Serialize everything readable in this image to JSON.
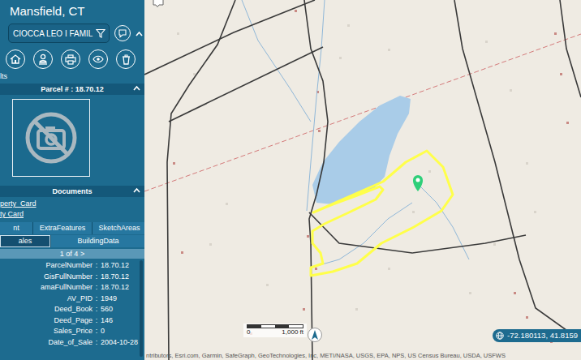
{
  "app": {
    "title": "Mansfield, CT"
  },
  "search": {
    "value": "CIOCCA LEO I FAMIL"
  },
  "results_label": "lts",
  "parcel": {
    "header": "Parcel # : 18.70.12"
  },
  "documents": {
    "header": "Documents",
    "links": [
      "perty_Card",
      "ty Card"
    ]
  },
  "tabs": [
    {
      "label": "nt",
      "selected": false
    },
    {
      "label": "ExtraFeatures",
      "selected": false
    },
    {
      "label": "SketchAreas",
      "selected": false
    },
    {
      "label": "ales",
      "selected": true
    },
    {
      "label": "BuildingData",
      "selected": false
    }
  ],
  "pager": "1 of 4 >",
  "field_separator": ":",
  "fields": [
    {
      "key": "ParcelNumber",
      "value": "18.70.12"
    },
    {
      "key": "GisFullNumber",
      "value": "18.70.12"
    },
    {
      "key": "amaFullNumber",
      "value": "18.70.12"
    },
    {
      "key": "AV_PID",
      "value": "1949"
    },
    {
      "key": "Deed_Book",
      "value": "560"
    },
    {
      "key": "Deed_Page",
      "value": "146"
    },
    {
      "key": "Sales_Price",
      "value": "0"
    },
    {
      "key": "Date_of_Sale",
      "value": "2004-10-28"
    }
  ],
  "map": {
    "scale": {
      "zero": "0",
      "label": "1,000 ft"
    },
    "attribution": "ntributors, Esri.com, Garmin, SafeGraph, GeoTechnologies, Inc, METI/NASA, USGS, EPA, NPS, US Census Bureau, USDA, USFWS",
    "coordinates": "-72.180113, 41.8159"
  }
}
